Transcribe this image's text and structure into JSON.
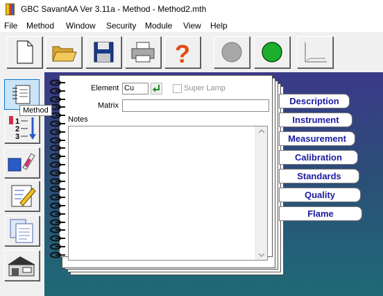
{
  "window": {
    "title": "GBC SavantAA Ver 3.11a - Method - Method2.mth"
  },
  "menu": [
    "File",
    "Method",
    "Window",
    "Security",
    "Module",
    "View",
    "Help"
  ],
  "toolbar": {
    "buttons": [
      "new-document",
      "open-folder",
      "save-disk",
      "printer",
      "help-question",
      "gray-lamp",
      "green-lamp",
      "graph"
    ]
  },
  "sidebar": {
    "items": [
      "method",
      "sequence",
      "samples",
      "edit",
      "reports",
      "lab"
    ],
    "tooltip": "Method"
  },
  "method": {
    "element_label": "Element",
    "element_value": "Cu",
    "super_lamp_label": "Super Lamp",
    "super_lamp_checked": false,
    "matrix_label": "Matrix",
    "matrix_value": "",
    "notes_label": "Notes",
    "notes_value": ""
  },
  "tabs": [
    "Description",
    "Instrument",
    "Measurement",
    "Calibration",
    "Standards",
    "Quality",
    "Flame"
  ],
  "colors": {
    "tab_text": "#1a1aa0",
    "background_top": "#3a3a88",
    "background_bottom": "#1f6a76"
  }
}
